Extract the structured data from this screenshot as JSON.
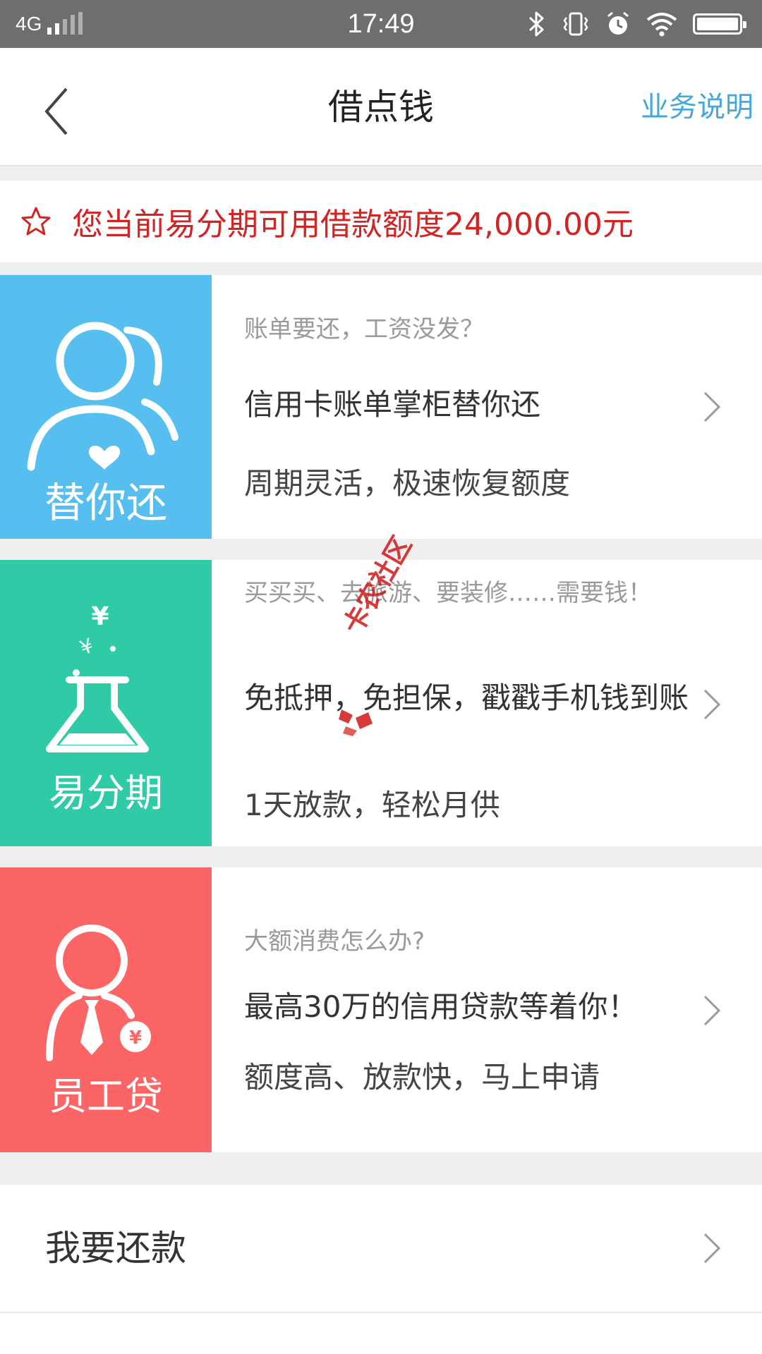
{
  "status_bar": {
    "network": "4G",
    "time": "17:49"
  },
  "header": {
    "title": "借点钱",
    "link_label": "业务说明"
  },
  "credit_banner": {
    "text": "您当前易分期可用借款额度24,000.00元"
  },
  "cards": [
    {
      "tile_label": "替你还",
      "tile_color": "#56bff0",
      "icon": "users-heart-icon",
      "subtitle": "账单要还，工资没发？",
      "headline": "信用卡账单掌柜替你还",
      "note": "周期灵活，极速恢复额度"
    },
    {
      "tile_label": "易分期",
      "tile_color": "#2ecba6",
      "icon": "flask-yen-icon",
      "subtitle": "买买买、去旅游、要装修……需要钱！",
      "headline": "免抵押，免担保，戳戳手机钱到账",
      "note": "1天放款，轻松月供"
    },
    {
      "tile_label": "员工贷",
      "tile_color": "#fb6565",
      "icon": "employee-tie-yen-icon",
      "subtitle": "大额消费怎么办?",
      "headline": "最高30万的信用贷款等着你！",
      "note": "额度高、放款快，马上申请"
    }
  ],
  "repay": {
    "label": "我要还款"
  },
  "watermark": {
    "text": "卡农社区"
  },
  "colors": {
    "accent_blue": "#45a7dd",
    "credit_red": "#d42323"
  }
}
